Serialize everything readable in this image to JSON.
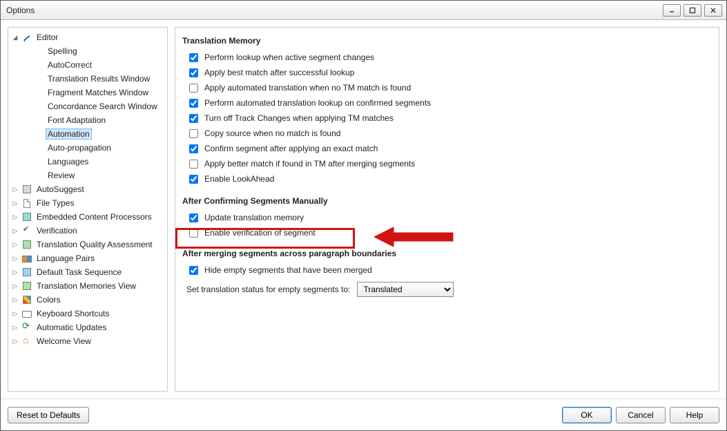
{
  "window": {
    "title": "Options"
  },
  "tree": {
    "editor": {
      "label": "Editor",
      "items": [
        "Spelling",
        "AutoCorrect",
        "Translation Results Window",
        "Fragment Matches Window",
        "Concordance Search Window",
        "Font Adaptation",
        "Automation",
        "Auto-propagation",
        "Languages",
        "Review"
      ],
      "selected_index": 6
    },
    "others": [
      "AutoSuggest",
      "File Types",
      "Embedded Content Processors",
      "Verification",
      "Translation Quality Assessment",
      "Language Pairs",
      "Default Task Sequence",
      "Translation Memories View",
      "Colors",
      "Keyboard Shortcuts",
      "Automatic Updates",
      "Welcome View"
    ]
  },
  "sections": {
    "tm": {
      "title": "Translation Memory",
      "opts": [
        {
          "label": "Perform lookup when active segment changes",
          "checked": true
        },
        {
          "label": "Apply best match after successful lookup",
          "checked": true
        },
        {
          "label": "Apply automated translation when no TM match is found",
          "checked": false
        },
        {
          "label": "Perform automated translation lookup on confirmed segments",
          "checked": true
        },
        {
          "label": "Turn off Track Changes when applying TM matches",
          "checked": true
        },
        {
          "label": "Copy source when no match is found",
          "checked": false
        },
        {
          "label": "Confirm segment after applying an exact match",
          "checked": true
        },
        {
          "label": "Apply better match if found in TM after merging segments",
          "checked": false
        },
        {
          "label": "Enable LookAhead",
          "checked": true
        }
      ]
    },
    "confirm": {
      "title": "After Confirming Segments Manually",
      "opts": [
        {
          "label": "Update translation memory",
          "checked": true
        },
        {
          "label": "Enable verification of segment",
          "checked": false
        }
      ]
    },
    "merge": {
      "title": "After merging segments across paragraph boundaries",
      "opts": [
        {
          "label": "Hide empty segments that have been merged",
          "checked": true
        }
      ],
      "status_label": "Set translation status for empty segments to:",
      "status_value": "Translated"
    }
  },
  "buttons": {
    "reset": "Reset to Defaults",
    "ok": "OK",
    "cancel": "Cancel",
    "help": "Help"
  }
}
